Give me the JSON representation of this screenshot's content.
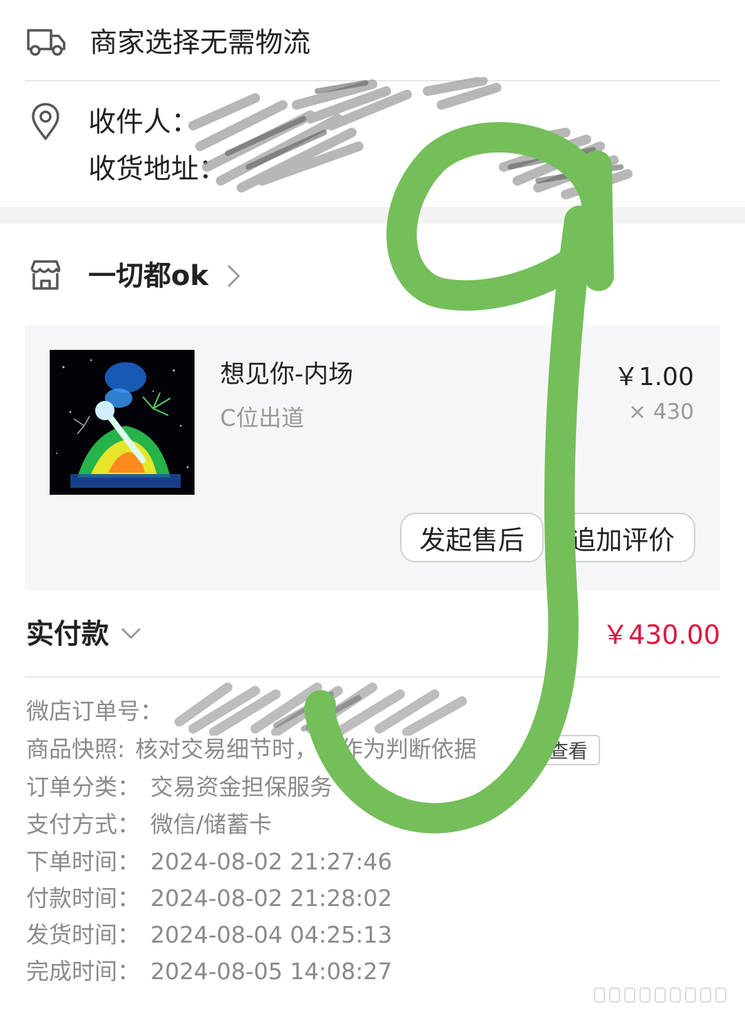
{
  "logistics": {
    "icon": "truck-icon",
    "text": "商家选择无需物流"
  },
  "address": {
    "icon": "location-pin-icon",
    "recipient_label": "收件人：",
    "address_label": "收货地址："
  },
  "shop": {
    "icon": "store-icon",
    "name": "一切都ok",
    "chevron_icon": "chevron-right-icon"
  },
  "product": {
    "title": "想见你-内场",
    "spec": "C位出道",
    "price": "￥1.00",
    "quantity": "× 430",
    "buttons": {
      "after_sale": "发起售后",
      "add_review": "追加评价"
    }
  },
  "payment": {
    "label": "实付款",
    "amount": "￥430.00",
    "amount_color": "#e0143c"
  },
  "details": {
    "order_no_label": "微店订单号：",
    "snapshot_label": "商品快照:",
    "snapshot_text": "核对交易细节时，可作为判断依据",
    "snapshot_button": "查看",
    "category_label": "订单分类：",
    "category_value": "交易资金担保服务",
    "pay_method_label": "支付方式：",
    "pay_method_value": "微信/储蓄卡",
    "order_time_label": "下单时间：",
    "order_time_value": "2024-08-02 21:27:46",
    "pay_time_label": "付款时间：",
    "pay_time_value": "2024-08-02 21:28:02",
    "ship_time_label": "发货时间：",
    "ship_time_value": "2024-08-04 04:25:13",
    "done_time_label": "完成时间：",
    "done_time_value": "2024-08-05 14:08:27"
  },
  "annotation": {
    "stroke_color": "#74bf5a"
  }
}
